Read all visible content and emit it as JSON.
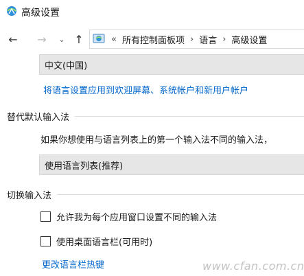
{
  "window": {
    "title": "高级设置"
  },
  "nav": {
    "back_glyph": "←",
    "forward_glyph": "→",
    "recent_glyph": "⌄",
    "up_glyph": "↑",
    "first_sep": "«",
    "separator": "›",
    "breadcrumbs": [
      "所有控制面板项",
      "语言",
      "高级设置"
    ]
  },
  "language_select": {
    "value": "中文(中国)"
  },
  "apply_link": {
    "label": "将语言设置应用到欢迎屏幕、系统帐户和新用户帐户"
  },
  "override_section": {
    "title": "替代默认输入法",
    "description": "如果你想使用与语言列表上的第一个输入法不同的输入法，",
    "select_value": "使用语言列表(推荐)"
  },
  "switch_section": {
    "title": "切换输入法",
    "checkboxes": [
      {
        "label": "允许我为每个应用窗口设置不同的输入法",
        "checked": false
      },
      {
        "label": "使用桌面语言栏(可用时)",
        "checked": false
      }
    ],
    "hotkey_link": "更改语言栏热键"
  },
  "watermark": "www.cfan.com.cn",
  "colors": {
    "link": "#0066cc",
    "select_bg": "#e6e6e6"
  }
}
